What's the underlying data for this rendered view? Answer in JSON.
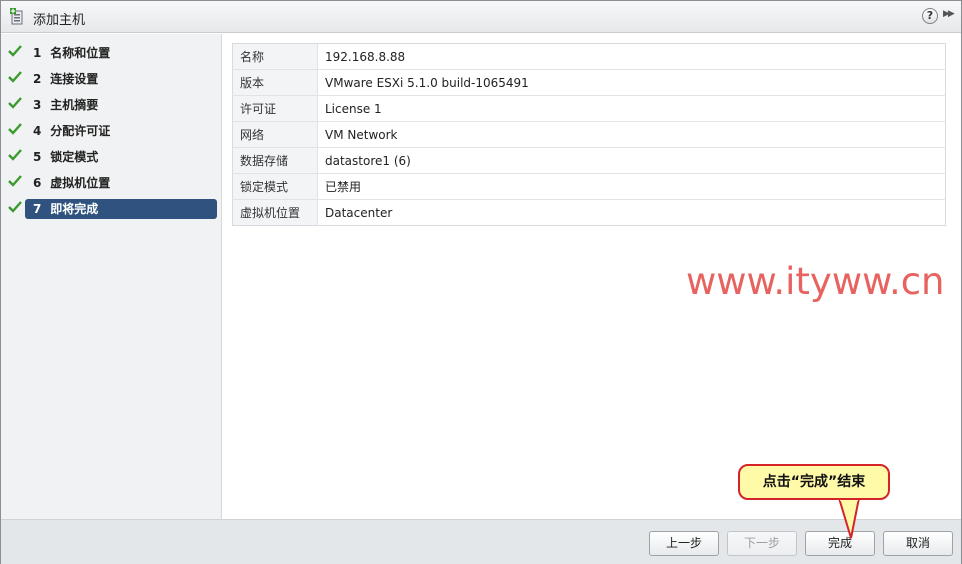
{
  "window": {
    "title": "添加主机",
    "help_label": "?",
    "expand_label": "▶▶"
  },
  "sidebar": {
    "steps": [
      {
        "num": "1",
        "label": "名称和位置",
        "done": true
      },
      {
        "num": "2",
        "label": "连接设置",
        "done": true
      },
      {
        "num": "3",
        "label": "主机摘要",
        "done": true
      },
      {
        "num": "4",
        "label": "分配许可证",
        "done": true
      },
      {
        "num": "5",
        "label": "锁定模式",
        "done": true
      },
      {
        "num": "6",
        "label": "虚拟机位置",
        "done": true
      },
      {
        "num": "7",
        "label": "即将完成",
        "done": true,
        "active": true
      }
    ]
  },
  "summary": {
    "rows": [
      {
        "key": "名称",
        "value": "192.168.8.88"
      },
      {
        "key": "版本",
        "value": "VMware ESXi 5.1.0 build-1065491"
      },
      {
        "key": "许可证",
        "value": "License 1"
      },
      {
        "key": "网络",
        "value": "VM Network"
      },
      {
        "key": "数据存储",
        "value": "datastore1 (6)"
      },
      {
        "key": "锁定模式",
        "value": "已禁用"
      },
      {
        "key": "虚拟机位置",
        "value": "Datacenter"
      }
    ]
  },
  "watermark": "www.ityww.cn",
  "footer": {
    "back_label": "上一步",
    "next_label": "下一步",
    "finish_label": "完成",
    "cancel_label": "取消"
  },
  "callout": {
    "text": "点击“完成”结束"
  },
  "colors": {
    "active_step": "#2f537e",
    "check": "#3a9b2e",
    "watermark": "#e7635f",
    "callout_bg": "#fffaa8",
    "callout_border": "#d4242a"
  }
}
